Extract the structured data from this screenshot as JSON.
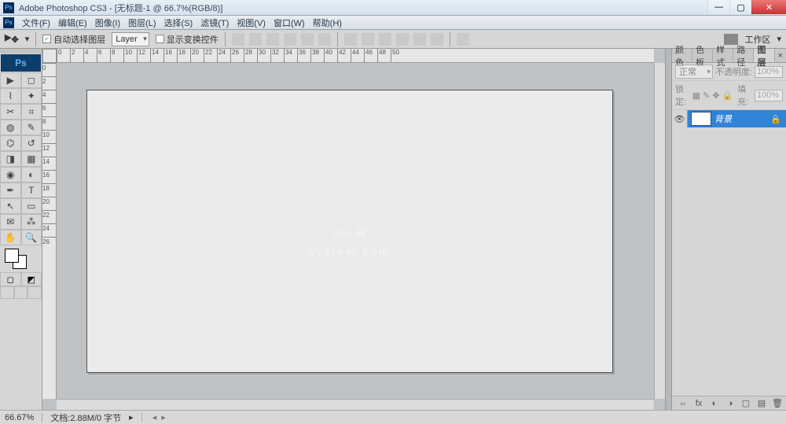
{
  "title": "Adobe Photoshop CS3 - [无标题-1 @ 66.7%(RGB/8)]",
  "menu": [
    "文件(F)",
    "编辑(E)",
    "图像(I)",
    "图层(L)",
    "选择(S)",
    "滤镜(T)",
    "视图(V)",
    "窗口(W)",
    "帮助(H)"
  ],
  "options": {
    "auto_select": "自动选择图层",
    "layer_dropdown": "Layer",
    "show_transform": "显示变换控件",
    "workspace": "工作区"
  },
  "ruler_h": [
    "0",
    "2",
    "4",
    "6",
    "8",
    "10",
    "12",
    "14",
    "16",
    "18",
    "20",
    "22",
    "24",
    "26",
    "28",
    "30",
    "32",
    "34",
    "36",
    "38",
    "40",
    "42",
    "44",
    "46",
    "48",
    "50"
  ],
  "ruler_v": [
    "0",
    "2",
    "4",
    "6",
    "8",
    "10",
    "12",
    "14",
    "16",
    "18",
    "20",
    "22",
    "24",
    "26"
  ],
  "watermark": {
    "main": "GXI 网",
    "sub": "system.com"
  },
  "panels": {
    "tabs": [
      "颜色",
      "色板",
      "样式",
      "路径",
      "图层"
    ],
    "blend_mode": "正常",
    "opacity_label": "不透明度:",
    "opacity_value": "100%",
    "lock_label": "锁定:",
    "fill_label": "填充:",
    "fill_value": "100%",
    "layer_name": "背景"
  },
  "status": {
    "zoom": "66.67%",
    "doc_info": "文档:2.88M/0 字节"
  }
}
